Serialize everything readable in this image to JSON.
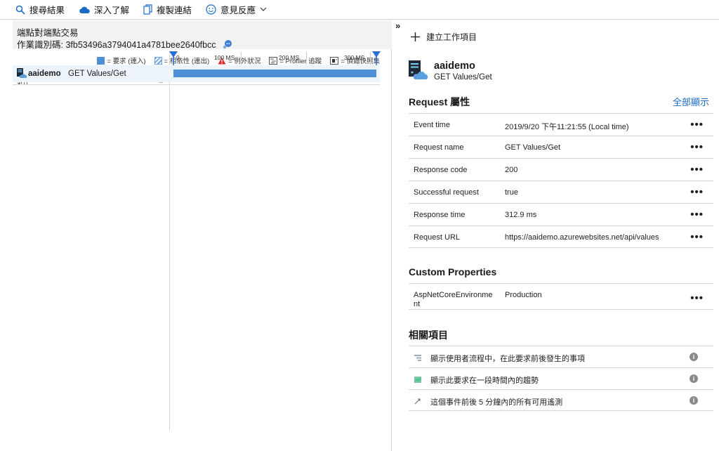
{
  "toolbar": {
    "search_results": "搜尋結果",
    "learn_more": "深入了解",
    "copy_link": "複製連結",
    "feedback": "意見反應"
  },
  "transaction": {
    "title": "端點對端點交易",
    "operation_id_label": "作業識別碼:",
    "operation_id": "3fb53496a3794041a4781bee2640fbcc"
  },
  "legend": {
    "request": "= 要求 (連入)",
    "dependency": "= 相依性 (連出)",
    "exception": "= 例外狀況",
    "profiler": "= Profiler 追蹤",
    "snapshot": "= 偵錯快照集"
  },
  "timeline": {
    "events_header": "事件",
    "ticks": [
      "0",
      "100 MS",
      "200 MS",
      "300 MS"
    ],
    "rows": [
      {
        "app": "aaidemo",
        "name": "GET Values/Get"
      }
    ]
  },
  "detail": {
    "collapse_glyph": "»",
    "create_work_item": "建立工作項目",
    "app_name": "aaidemo",
    "app_sub": "GET Values/Get",
    "request_props_title": "Request 屬性",
    "show_all": "全部顯示",
    "properties": [
      {
        "key": "Event time",
        "value": "2019/9/20 下午11:21:55 (Local time)"
      },
      {
        "key": "Request name",
        "value": "GET Values/Get"
      },
      {
        "key": "Response code",
        "value": "200"
      },
      {
        "key": "Successful request",
        "value": "true"
      },
      {
        "key": "Response time",
        "value": "312.9 ms"
      },
      {
        "key": "Request URL",
        "value": "https://aaidemo.azurewebsites.net/api/values"
      }
    ],
    "custom_props_title": "Custom Properties",
    "custom_properties": [
      {
        "key": "AspNetCoreEnvironment",
        "value": "Production"
      }
    ],
    "related_title": "相關項目",
    "related": [
      {
        "icon": "user-flow-icon",
        "text": "顯示使用者流程中，在此要求前後發生的事項"
      },
      {
        "icon": "chart-icon",
        "text": "顯示此要求在一段時間內的趨勢"
      },
      {
        "icon": "arrow-icon",
        "text": "這個事件前後 5 分鐘內的所有可用遙測"
      }
    ],
    "more_glyph": "•••",
    "info_glyph": "i"
  },
  "colors": {
    "accent": "#1a6bc5",
    "request_bar": "#4d90d6",
    "marker": "#2b6fd6"
  }
}
